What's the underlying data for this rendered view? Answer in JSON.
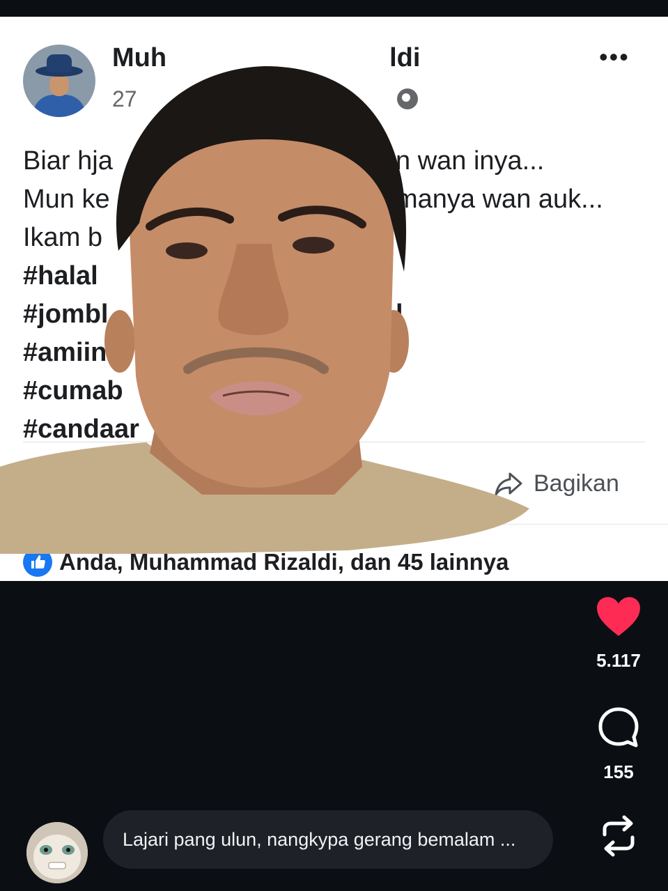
{
  "post": {
    "author": "Muh",
    "author_tail": "ldi",
    "meta_date": "27",
    "post_lines": [
      "Biar hja",
      "Mun ke",
      "Ikam b"
    ],
    "post_line_tails": [
      "n wan inya...",
      "manya wan auk...",
      ""
    ],
    "hashtags": [
      "#halal",
      "#jombl",
      "#amiin",
      "#cumab",
      "#candaar"
    ],
    "share_label": "Bagikan",
    "reactions_text": "Anda, Muhammad Rizaldi, dan 45 lainnya"
  },
  "video": {
    "like_count": "5.117",
    "comment_count": "155",
    "comment_preview": "Lajari pang ulun, nangkypa gerang bemalam ..."
  },
  "icons": {
    "heart": "heart-icon",
    "comment": "comment-icon",
    "repost": "repost-icon",
    "like": "thumbs-up-icon",
    "globe": "globe-icon",
    "more": "more-icon",
    "share": "share-arrow-icon"
  },
  "colors": {
    "heart": "#fe2c55",
    "facebook_blue": "#1877f2",
    "background": "#0b0f14"
  }
}
